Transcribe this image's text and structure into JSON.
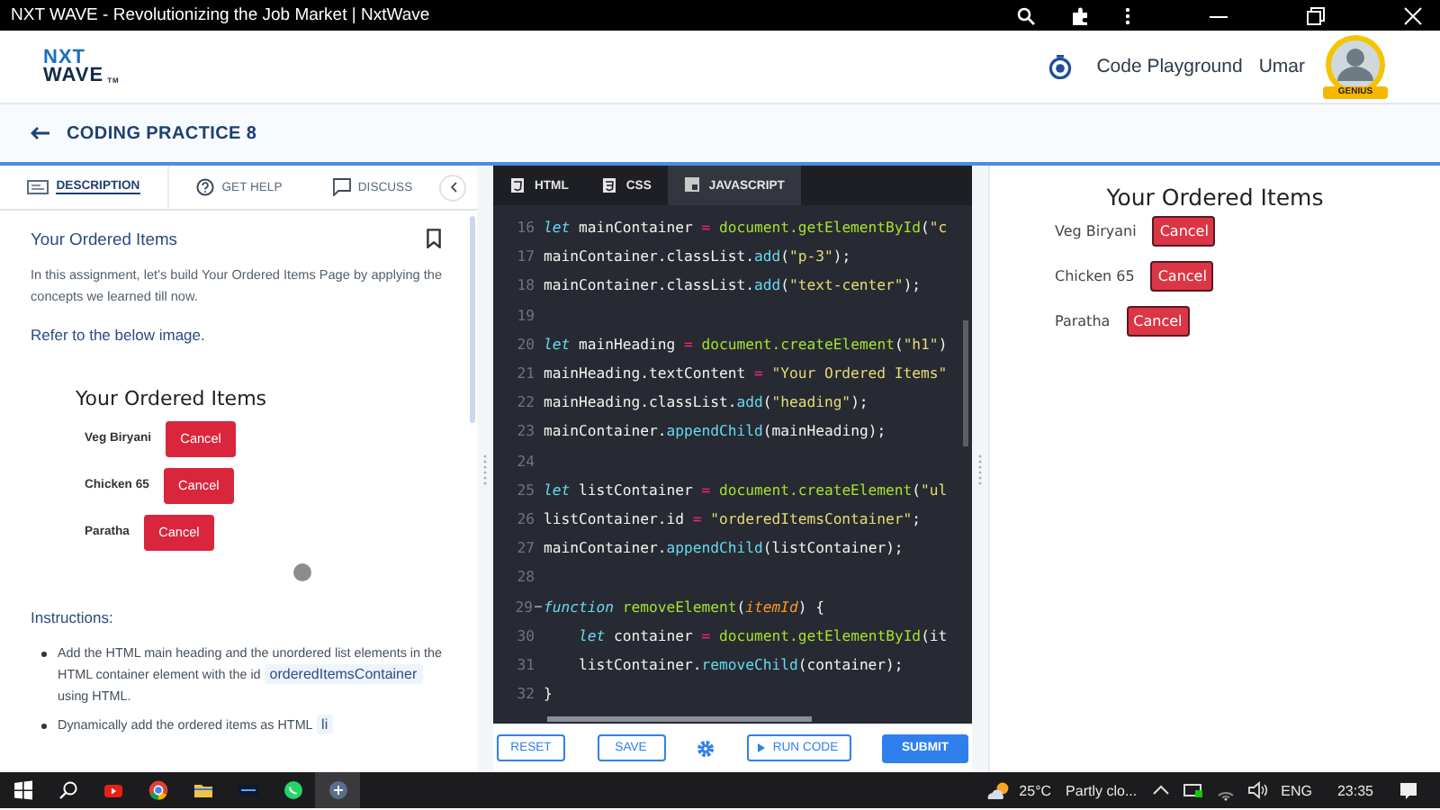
{
  "browser_window": {
    "title": "NXT WAVE - Revolutionizing the Job Market | NxtWave"
  },
  "header": {
    "logo": {
      "line_1": "NXT",
      "line_2": "WAVE",
      "mark": "TM"
    },
    "nav_link": "Code Playground",
    "user_name": "Umar",
    "badge": "GENIUS"
  },
  "page_header": {
    "title": "CODING PRACTICE 8"
  },
  "description_panel": {
    "tabs": [
      {
        "label": "DESCRIPTION",
        "selected": true
      },
      {
        "label": "GET HELP",
        "selected": false
      },
      {
        "label": "DISCUSS",
        "selected": false
      }
    ],
    "title": "Your Ordered Items",
    "intro": "In this assignment, let's build Your Ordered Items Page by applying the concepts we learned till now.",
    "refer_note": "Refer to the below image.",
    "preview": {
      "heading": "Your Ordered Items",
      "items": [
        {
          "name": "Veg Biryani",
          "button": "Cancel"
        },
        {
          "name": "Chicken 65",
          "button": "Cancel"
        },
        {
          "name": "Paratha",
          "button": "Cancel"
        }
      ]
    },
    "instructions_heading": "Instructions:",
    "instructions": [
      {
        "text": "Add the HTML main heading and the unordered list elements in the HTML container element with the id",
        "code": "orderedItemsContainer",
        "after": "using HTML."
      },
      {
        "text": "Dynamically add the ordered items as HTML",
        "code": "li"
      }
    ]
  },
  "editor": {
    "tabs": [
      {
        "label": "HTML",
        "selected": false
      },
      {
        "label": "CSS",
        "selected": false
      },
      {
        "label": "JAVASCRIPT",
        "selected": true
      }
    ],
    "lines": [
      {
        "number": "16",
        "foldable": false,
        "tokens": [
          {
            "kind": "keyword",
            "text": "let"
          },
          {
            "kind": "plain",
            "text": " mainContainer "
          },
          {
            "kind": "operator",
            "text": "= "
          },
          {
            "kind": "object",
            "text": "document.getElementById"
          },
          {
            "kind": "plain",
            "text": "("
          },
          {
            "kind": "string",
            "text": "\"c"
          }
        ]
      },
      {
        "number": "17",
        "foldable": false,
        "tokens": [
          {
            "kind": "plain",
            "text": "mainContainer.classList."
          },
          {
            "kind": "method",
            "text": "add"
          },
          {
            "kind": "plain",
            "text": "("
          },
          {
            "kind": "string",
            "text": "\"p-3\""
          },
          {
            "kind": "plain",
            "text": ");"
          }
        ]
      },
      {
        "number": "18",
        "foldable": false,
        "tokens": [
          {
            "kind": "plain",
            "text": "mainContainer.classList."
          },
          {
            "kind": "method",
            "text": "add"
          },
          {
            "kind": "plain",
            "text": "("
          },
          {
            "kind": "string",
            "text": "\"text-center\""
          },
          {
            "kind": "plain",
            "text": ");"
          }
        ]
      },
      {
        "number": "19",
        "foldable": false
      },
      {
        "number": "20",
        "foldable": false,
        "tokens": [
          {
            "kind": "keyword",
            "text": "let"
          },
          {
            "kind": "plain",
            "text": " mainHeading "
          },
          {
            "kind": "operator",
            "text": "= "
          },
          {
            "kind": "object",
            "text": "document.createElement"
          },
          {
            "kind": "plain",
            "text": "("
          },
          {
            "kind": "string",
            "text": "\"h1\""
          },
          {
            "kind": "plain",
            "text": ")"
          }
        ]
      },
      {
        "number": "21",
        "foldable": false,
        "tokens": [
          {
            "kind": "plain",
            "text": "mainHeading.textContent "
          },
          {
            "kind": "operator",
            "text": "= "
          },
          {
            "kind": "string",
            "text": "\"Your Ordered Items\""
          }
        ]
      },
      {
        "number": "22",
        "foldable": false,
        "tokens": [
          {
            "kind": "plain",
            "text": "mainHeading.classList."
          },
          {
            "kind": "method",
            "text": "add"
          },
          {
            "kind": "plain",
            "text": "("
          },
          {
            "kind": "string",
            "text": "\"heading\""
          },
          {
            "kind": "plain",
            "text": ");"
          }
        ]
      },
      {
        "number": "23",
        "foldable": false,
        "tokens": [
          {
            "kind": "plain",
            "text": "mainContainer."
          },
          {
            "kind": "method",
            "text": "appendChild"
          },
          {
            "kind": "plain",
            "text": "(mainHeading);"
          }
        ]
      },
      {
        "number": "24",
        "foldable": false
      },
      {
        "number": "25",
        "foldable": false,
        "tokens": [
          {
            "kind": "keyword",
            "text": "let"
          },
          {
            "kind": "plain",
            "text": " listContainer "
          },
          {
            "kind": "operator",
            "text": "= "
          },
          {
            "kind": "object",
            "text": "document.createElement"
          },
          {
            "kind": "plain",
            "text": "("
          },
          {
            "kind": "string",
            "text": "\"ul"
          }
        ]
      },
      {
        "number": "26",
        "foldable": false,
        "tokens": [
          {
            "kind": "plain",
            "text": "listContainer.id "
          },
          {
            "kind": "operator",
            "text": "= "
          },
          {
            "kind": "string",
            "text": "\"orderedItemsContainer\""
          },
          {
            "kind": "plain",
            "text": ";"
          }
        ]
      },
      {
        "number": "27",
        "foldable": false,
        "tokens": [
          {
            "kind": "plain",
            "text": "mainContainer."
          },
          {
            "kind": "method",
            "text": "appendChild"
          },
          {
            "kind": "plain",
            "text": "(listContainer);"
          }
        ]
      },
      {
        "number": "28",
        "foldable": false
      },
      {
        "number": "29",
        "foldable": true,
        "tokens": [
          {
            "kind": "keyword",
            "text": "function "
          },
          {
            "kind": "object",
            "text": "removeElement"
          },
          {
            "kind": "plain",
            "text": "("
          },
          {
            "kind": "parameter",
            "text": "itemId"
          },
          {
            "kind": "plain",
            "text": ") {"
          }
        ]
      },
      {
        "number": "30",
        "foldable": false,
        "tokens": [
          {
            "kind": "keyword",
            "text": "    let"
          },
          {
            "kind": "plain",
            "text": " container "
          },
          {
            "kind": "operator",
            "text": "= "
          },
          {
            "kind": "object",
            "text": "document.getElementById"
          },
          {
            "kind": "plain",
            "text": "(it"
          }
        ]
      },
      {
        "number": "31",
        "foldable": false,
        "tokens": [
          {
            "kind": "plain",
            "text": "    listContainer."
          },
          {
            "kind": "method",
            "text": "removeChild"
          },
          {
            "kind": "plain",
            "text": "(container);"
          }
        ]
      },
      {
        "number": "32",
        "foldable": false,
        "tokens": [
          {
            "kind": "plain",
            "text": "}"
          }
        ]
      }
    ],
    "buttons": {
      "reset": "RESET",
      "save": "SAVE",
      "run": "RUN CODE",
      "submit": "SUBMIT"
    }
  },
  "output_panel": {
    "heading": "Your Ordered Items",
    "items": [
      {
        "name": "Veg Biryani",
        "button": "Cancel"
      },
      {
        "name": "Chicken 65",
        "button": "Cancel"
      },
      {
        "name": "Paratha",
        "button": "Cancel"
      }
    ]
  },
  "taskbar": {
    "weather": {
      "temperature": "25°C",
      "condition": "Partly clo..."
    },
    "language": "ENG",
    "time": "23:35"
  }
}
